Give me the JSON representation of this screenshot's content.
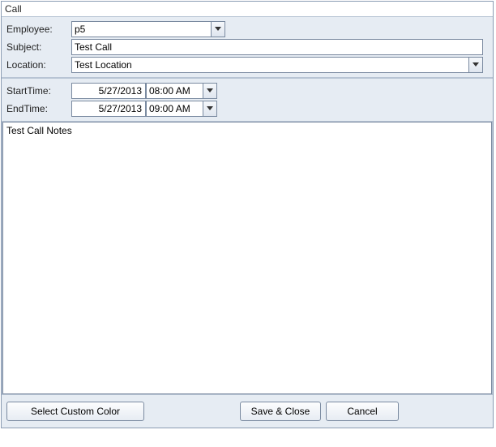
{
  "window": {
    "title": "Call"
  },
  "labels": {
    "employee": "Employee:",
    "subject": "Subject:",
    "location": "Location:",
    "start_time": "StartTime:",
    "end_time": "EndTime:"
  },
  "fields": {
    "employee": "p5",
    "subject": "Test Call",
    "location": "Test Location",
    "start_date": "5/27/2013",
    "start_time": "08:00 AM",
    "end_date": "5/27/2013",
    "end_time": "09:00 AM",
    "notes": "Test Call Notes"
  },
  "buttons": {
    "select_color": "Select Custom Color",
    "save_close": "Save & Close",
    "cancel": "Cancel"
  }
}
